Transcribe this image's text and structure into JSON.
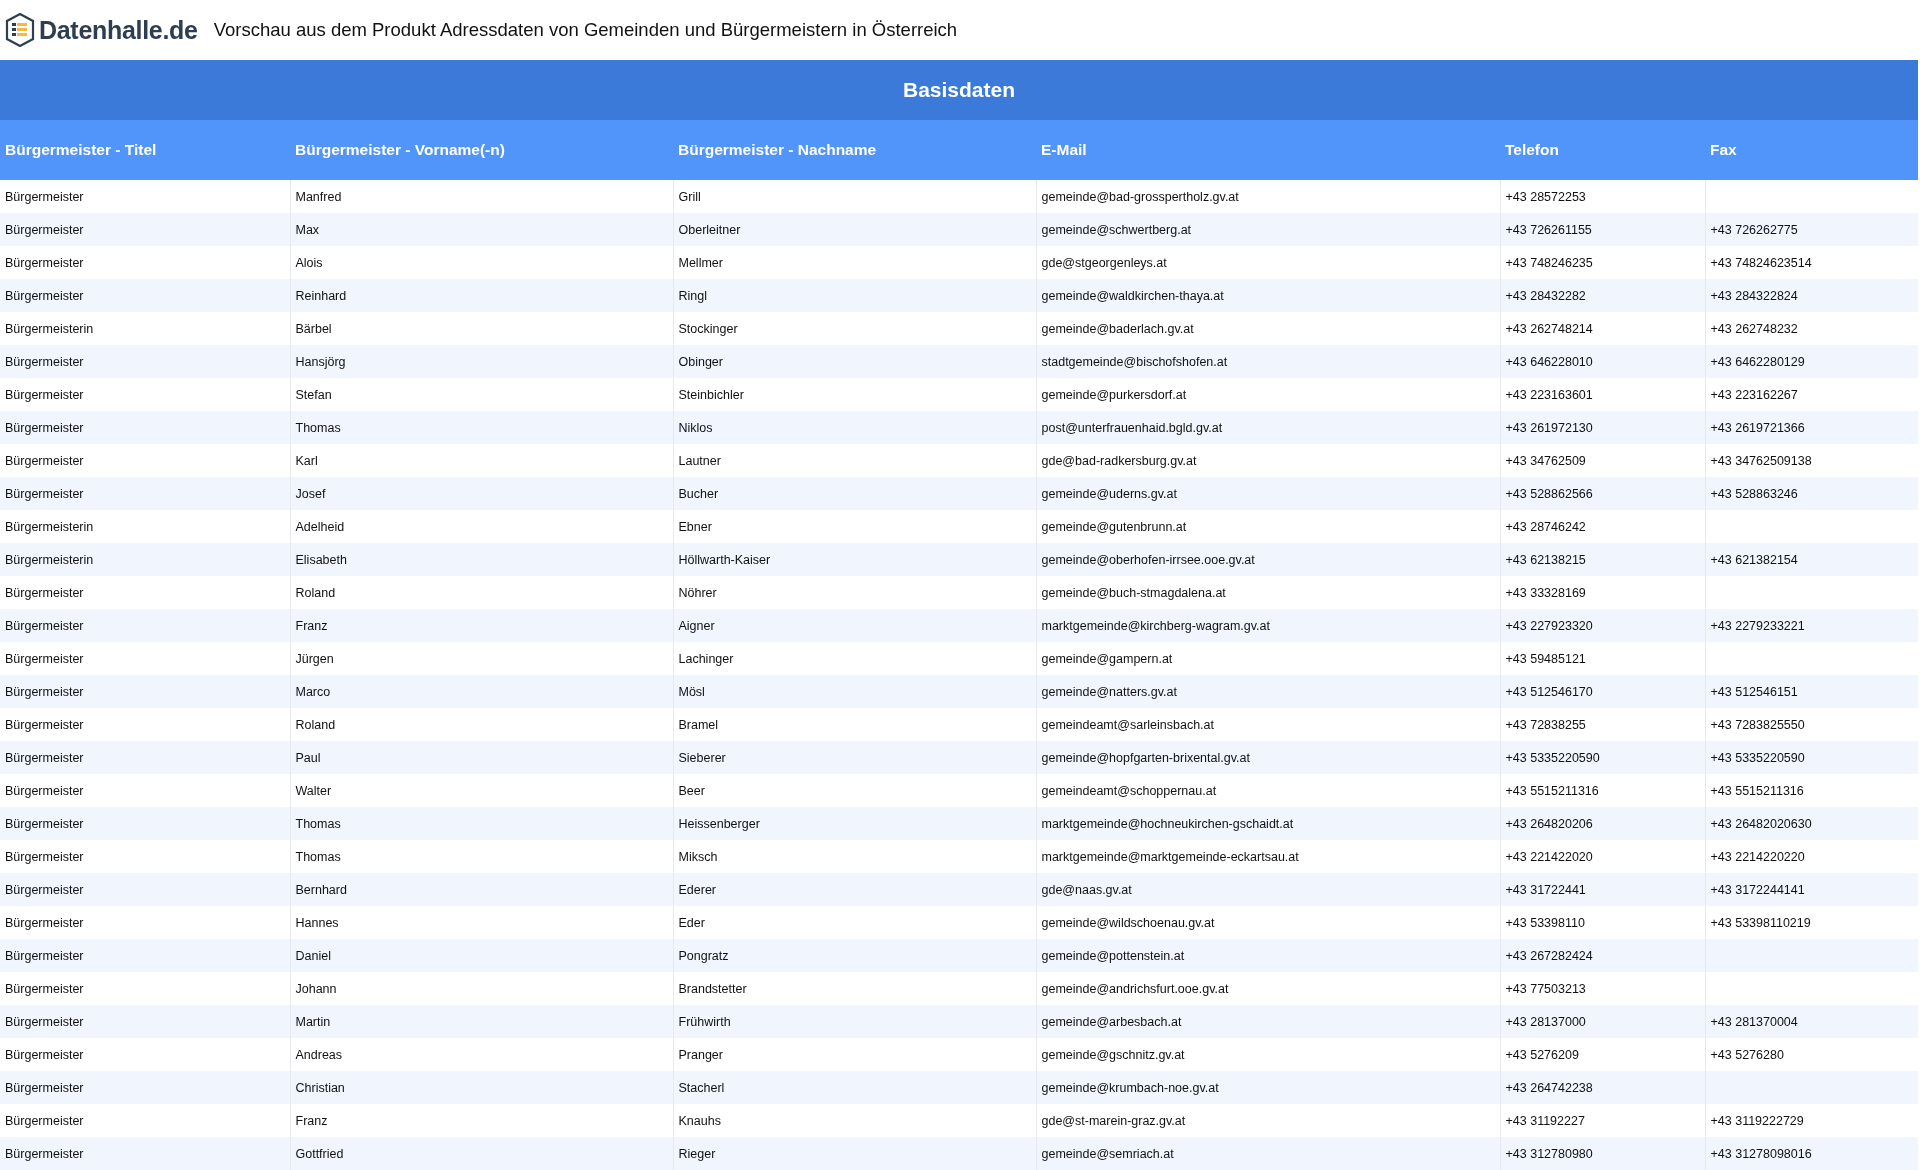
{
  "header": {
    "logo_text": "Datenhalle.de",
    "title": "Vorschau aus dem Produkt Adressdaten von Gemeinden und Bürgermeistern in Österreich"
  },
  "table": {
    "group_title": "Basisdaten",
    "columns": [
      "Bürgermeister - Titel",
      "Bürgermeister - Vorname(-n)",
      "Bürgermeister - Nachname",
      "E-Mail",
      "Telefon",
      "Fax"
    ],
    "rows": [
      [
        "Bürgermeister",
        "Manfred",
        "Grill",
        "gemeinde@bad-grosspertholz.gv.at",
        "+43 28572253",
        null
      ],
      [
        "Bürgermeister",
        "Max",
        "Oberleitner",
        "gemeinde@schwertberg.at",
        "+43 726261155",
        "+43 726262775"
      ],
      [
        "Bürgermeister",
        "Alois",
        "Mellmer",
        "gde@stgeorgenleys.at",
        "+43 748246235",
        "+43 74824623514"
      ],
      [
        "Bürgermeister",
        "Reinhard",
        "Ringl",
        "gemeinde@waldkirchen-thaya.at",
        "+43 28432282",
        "+43 284322824"
      ],
      [
        "Bürgermeisterin",
        "Bärbel",
        "Stockinger",
        "gemeinde@baderlach.gv.at",
        "+43 262748214",
        "+43 262748232"
      ],
      [
        "Bürgermeister",
        "Hansjörg",
        "Obinger",
        "stadtgemeinde@bischofshofen.at",
        "+43 646228010",
        "+43 6462280129"
      ],
      [
        "Bürgermeister",
        "Stefan",
        "Steinbichler",
        "gemeinde@purkersdorf.at",
        "+43 223163601",
        "+43 223162267"
      ],
      [
        "Bürgermeister",
        "Thomas",
        "Niklos",
        "post@unterfrauenhaid.bgld.gv.at",
        "+43 261972130",
        "+43 2619721366"
      ],
      [
        "Bürgermeister",
        "Karl",
        "Lautner",
        "gde@bad-radkersburg.gv.at",
        "+43 34762509",
        "+43 34762509138"
      ],
      [
        "Bürgermeister",
        "Josef",
        "Bucher",
        "gemeinde@uderns.gv.at",
        "+43 528862566",
        "+43 528863246"
      ],
      [
        "Bürgermeisterin",
        "Adelheid",
        "Ebner",
        "gemeinde@gutenbrunn.at",
        "+43 28746242",
        null
      ],
      [
        "Bürgermeisterin",
        "Elisabeth",
        "Höllwarth-Kaiser",
        "gemeinde@oberhofen-irrsee.ooe.gv.at",
        "+43 62138215",
        "+43 621382154"
      ],
      [
        "Bürgermeister",
        "Roland",
        "Nöhrer",
        "gemeinde@buch-stmagdalena.at",
        "+43 33328169",
        null
      ],
      [
        "Bürgermeister",
        "Franz",
        "Aigner",
        "marktgemeinde@kirchberg-wagram.gv.at",
        "+43 227923320",
        "+43 2279233221"
      ],
      [
        "Bürgermeister",
        "Jürgen",
        "Lachinger",
        "gemeinde@gampern.at",
        "+43 59485121",
        null
      ],
      [
        "Bürgermeister",
        "Marco",
        "Mösl",
        "gemeinde@natters.gv.at",
        "+43 512546170",
        "+43 512546151"
      ],
      [
        "Bürgermeister",
        "Roland",
        "Bramel",
        "gemeindeamt@sarleinsbach.at",
        "+43 72838255",
        "+43 7283825550"
      ],
      [
        "Bürgermeister",
        "Paul",
        "Sieberer",
        "gemeinde@hopfgarten-brixental.gv.at",
        "+43 5335220590",
        "+43 5335220590"
      ],
      [
        "Bürgermeister",
        "Walter",
        "Beer",
        "gemeindeamt@schoppernau.at",
        "+43 5515211316",
        "+43 5515211316"
      ],
      [
        "Bürgermeister",
        "Thomas",
        "Heissenberger",
        "marktgemeinde@hochneukirchen-gschaidt.at",
        "+43 264820206",
        "+43 26482020630"
      ],
      [
        "Bürgermeister",
        "Thomas",
        "Miksch",
        "marktgemeinde@marktgemeinde-eckartsau.at",
        "+43 221422020",
        "+43 2214220220"
      ],
      [
        "Bürgermeister",
        "Bernhard",
        "Ederer",
        "gde@naas.gv.at",
        "+43 31722441",
        "+43 3172244141"
      ],
      [
        "Bürgermeister",
        "Hannes",
        "Eder",
        "gemeinde@wildschoenau.gv.at",
        "+43 53398110",
        "+43 53398110219"
      ],
      [
        "Bürgermeister",
        "Daniel",
        "Pongratz",
        "gemeinde@pottenstein.at",
        "+43 267282424",
        null
      ],
      [
        "Bürgermeister",
        "Johann",
        "Brandstetter",
        "gemeinde@andrichsfurt.ooe.gv.at",
        "+43 77503213",
        null
      ],
      [
        "Bürgermeister",
        "Martin",
        "Frühwirth",
        "gemeinde@arbesbach.at",
        "+43 28137000",
        "+43 281370004"
      ],
      [
        "Bürgermeister",
        "Andreas",
        "Pranger",
        "gemeinde@gschnitz.gv.at",
        "+43 5276209",
        "+43 5276280"
      ],
      [
        "Bürgermeister",
        "Christian",
        "Stacherl",
        "gemeinde@krumbach-noe.gv.at",
        "+43 264742238",
        null
      ],
      [
        "Bürgermeister",
        "Franz",
        "Knauhs",
        "gde@st-marein-graz.gv.at",
        "+43 31192227",
        "+43 3119222729"
      ],
      [
        "Bürgermeister",
        "Gottfried",
        "Rieger",
        "gemeinde@semriach.at",
        "+43 312780980",
        "+43 31278098016"
      ]
    ]
  }
}
